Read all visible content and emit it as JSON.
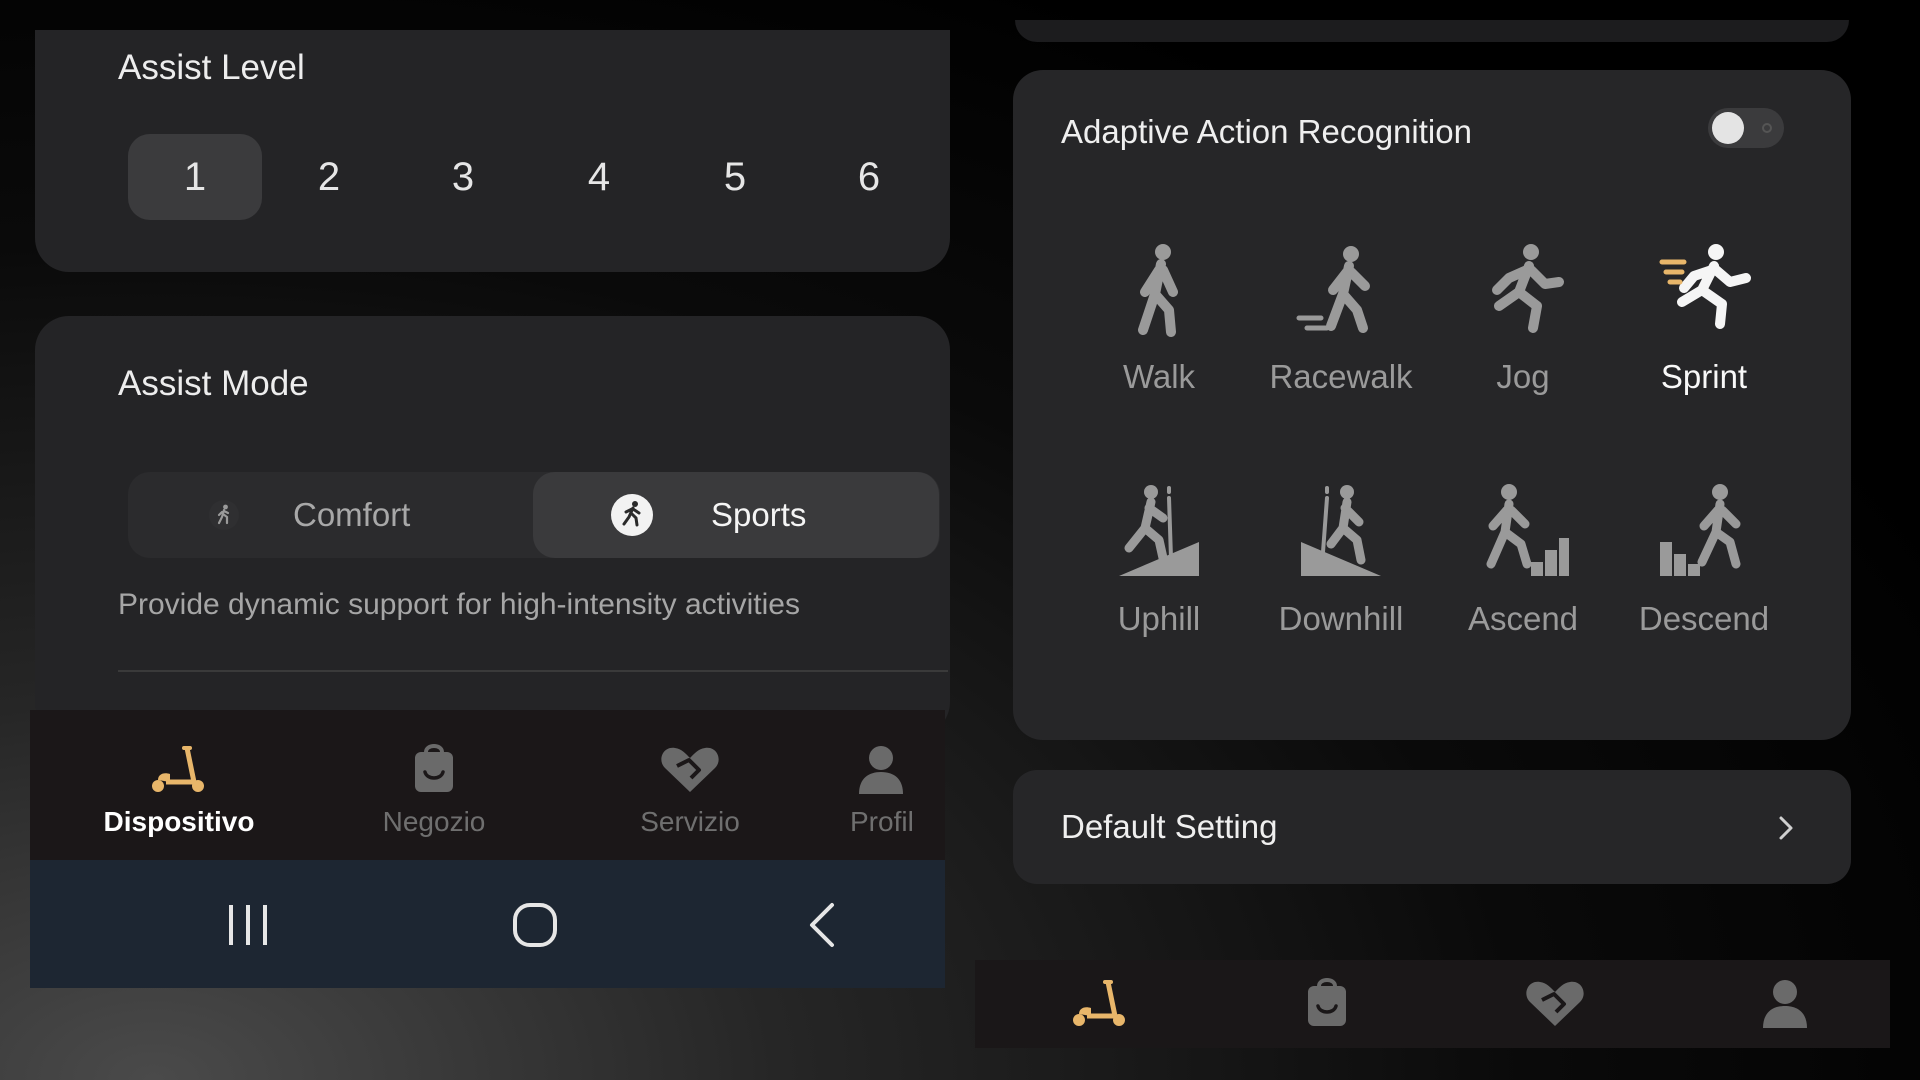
{
  "assist_level": {
    "title": "Assist Level",
    "levels": [
      "1",
      "2",
      "3",
      "4",
      "5",
      "6"
    ],
    "selected": "1"
  },
  "assist_mode": {
    "title": "Assist Mode",
    "options": [
      {
        "label": "Comfort",
        "icon": "walking-person-icon"
      },
      {
        "label": "Sports",
        "icon": "running-person-icon"
      }
    ],
    "selected": "Sports",
    "description": "Provide dynamic support for high-intensity activities"
  },
  "tabbar": {
    "items": [
      {
        "label": "Dispositivo",
        "icon": "scooter-icon"
      },
      {
        "label": "Negozio",
        "icon": "shopping-bag-icon"
      },
      {
        "label": "Servizio",
        "icon": "heart-handshake-icon"
      },
      {
        "label": "Profil",
        "icon": "profile-icon"
      }
    ],
    "active": "Dispositivo"
  },
  "system_nav": {
    "items": [
      "recent-apps-icon",
      "home-icon",
      "back-icon"
    ]
  },
  "adaptive_action_recognition": {
    "title": "Adaptive Action Recognition",
    "toggle_on": false,
    "actions": [
      {
        "label": "Walk",
        "icon": "walk-icon"
      },
      {
        "label": "Racewalk",
        "icon": "racewalk-icon"
      },
      {
        "label": "Jog",
        "icon": "jog-icon"
      },
      {
        "label": "Sprint",
        "icon": "sprint-icon"
      },
      {
        "label": "Uphill",
        "icon": "uphill-icon"
      },
      {
        "label": "Downhill",
        "icon": "downhill-icon"
      },
      {
        "label": "Ascend",
        "icon": "ascend-icon"
      },
      {
        "label": "Descend",
        "icon": "descend-icon"
      }
    ],
    "highlighted": "Sprint"
  },
  "default_setting": {
    "label": "Default Setting"
  },
  "colors": {
    "accent": "#e8b66a",
    "active_text": "#ffffff",
    "inactive_text": "#6f6f6f",
    "card_bg": "#242426"
  }
}
